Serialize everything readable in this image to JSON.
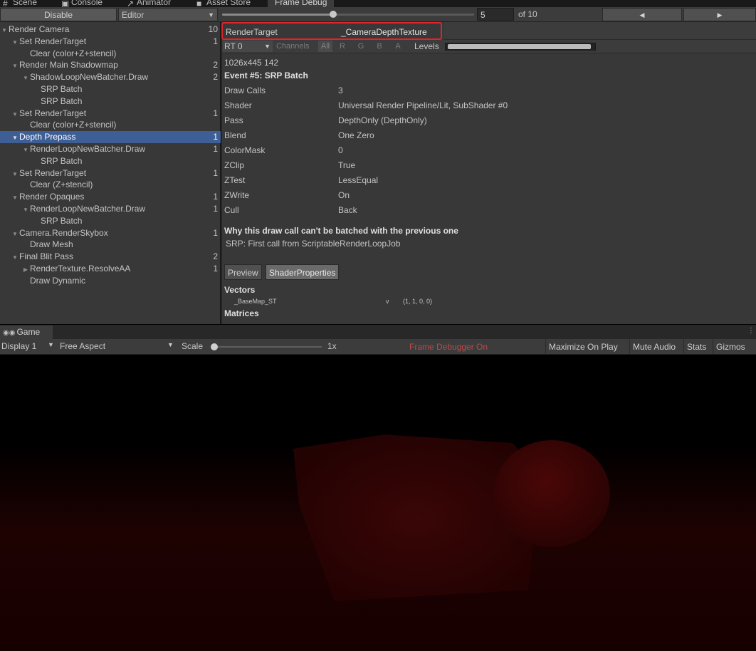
{
  "tabs": [
    {
      "label": "Scene",
      "icon": "hash-icon"
    },
    {
      "label": "Console",
      "icon": "console-icon"
    },
    {
      "label": "Animator",
      "icon": "animator-icon"
    },
    {
      "label": "Asset Store",
      "icon": "store-icon"
    },
    {
      "label": "Frame Debug",
      "active": true
    }
  ],
  "toolbar": {
    "disable_label": "Disable",
    "editor_label": "Editor",
    "event_index": "5",
    "event_total": "of 10",
    "slider_fraction": 0.44
  },
  "tree": [
    {
      "label": "Render Camera",
      "count": "10",
      "depth": 0,
      "expanded": true
    },
    {
      "label": "Set RenderTarget",
      "count": "1",
      "depth": 1,
      "expanded": true
    },
    {
      "label": "Clear (color+Z+stencil)",
      "count": "",
      "depth": 2
    },
    {
      "label": "Render Main Shadowmap",
      "count": "2",
      "depth": 1,
      "expanded": true
    },
    {
      "label": "ShadowLoopNewBatcher.Draw",
      "count": "2",
      "depth": 2,
      "expanded": true
    },
    {
      "label": "SRP Batch",
      "count": "",
      "depth": 3
    },
    {
      "label": "SRP Batch",
      "count": "",
      "depth": 3
    },
    {
      "label": "Set RenderTarget",
      "count": "1",
      "depth": 1,
      "expanded": true
    },
    {
      "label": "Clear (color+Z+stencil)",
      "count": "",
      "depth": 2
    },
    {
      "label": "Depth Prepass",
      "count": "1",
      "depth": 1,
      "expanded": true,
      "selected": true
    },
    {
      "label": "RenderLoopNewBatcher.Draw",
      "count": "1",
      "depth": 2,
      "expanded": true
    },
    {
      "label": "SRP Batch",
      "count": "",
      "depth": 3
    },
    {
      "label": "Set RenderTarget",
      "count": "1",
      "depth": 1,
      "expanded": true
    },
    {
      "label": "Clear (Z+stencil)",
      "count": "",
      "depth": 2
    },
    {
      "label": "Render Opaques",
      "count": "1",
      "depth": 1,
      "expanded": true
    },
    {
      "label": "RenderLoopNewBatcher.Draw",
      "count": "1",
      "depth": 2,
      "expanded": true
    },
    {
      "label": "SRP Batch",
      "count": "",
      "depth": 3
    },
    {
      "label": "Camera.RenderSkybox",
      "count": "1",
      "depth": 1,
      "expanded": true
    },
    {
      "label": "Draw Mesh",
      "count": "",
      "depth": 2
    },
    {
      "label": "Final Blit Pass",
      "count": "2",
      "depth": 1,
      "expanded": true
    },
    {
      "label": "RenderTexture.ResolveAA",
      "count": "1",
      "depth": 2,
      "expanded": false
    },
    {
      "label": "Draw Dynamic",
      "count": "",
      "depth": 2
    }
  ],
  "details": {
    "render_target_label": "RenderTarget",
    "render_target_value": "_CameraDepthTexture",
    "rt_select": "RT 0",
    "channels_label": "Channels",
    "channel_buttons": [
      "All",
      "R",
      "G",
      "B",
      "A"
    ],
    "levels_label": "Levels",
    "dimensions": "1026x445 142",
    "event_title": "Event #5: SRP Batch",
    "properties": [
      {
        "key": "Draw Calls",
        "value": "3"
      },
      {
        "key": "Shader",
        "value": "Universal Render Pipeline/Lit, SubShader #0"
      },
      {
        "key": "Pass",
        "value": "DepthOnly (DepthOnly)"
      },
      {
        "key": "Blend",
        "value": "One Zero"
      },
      {
        "key": "ColorMask",
        "value": "0"
      },
      {
        "key": "ZClip",
        "value": "True"
      },
      {
        "key": "ZTest",
        "value": "LessEqual"
      },
      {
        "key": "ZWrite",
        "value": "On"
      },
      {
        "key": "Cull",
        "value": "Back"
      }
    ],
    "why_title": "Why this draw call can't be batched with the previous one",
    "why_reason": "SRP: First call from ScriptableRenderLoopJob",
    "tab_preview": "Preview",
    "tab_shader_props": "ShaderProperties",
    "vectors_heading": "Vectors",
    "vector_name": "_BaseMap_ST",
    "vector_type": "v",
    "vector_value": "(1, 1, 0, 0)",
    "matrices_heading": "Matrices"
  },
  "game": {
    "tab_label": "Game",
    "display": "Display 1",
    "aspect": "Free Aspect",
    "scale_label": "Scale",
    "scale_value": "1x",
    "frame_debugger_status": "Frame Debugger On",
    "right_buttons": [
      "Maximize On Play",
      "Mute Audio",
      "Stats",
      "Gizmos"
    ]
  },
  "colors": {
    "selection": "#3e5f96",
    "highlight_box": "#e0242a",
    "status_red": "#b94a4a"
  }
}
